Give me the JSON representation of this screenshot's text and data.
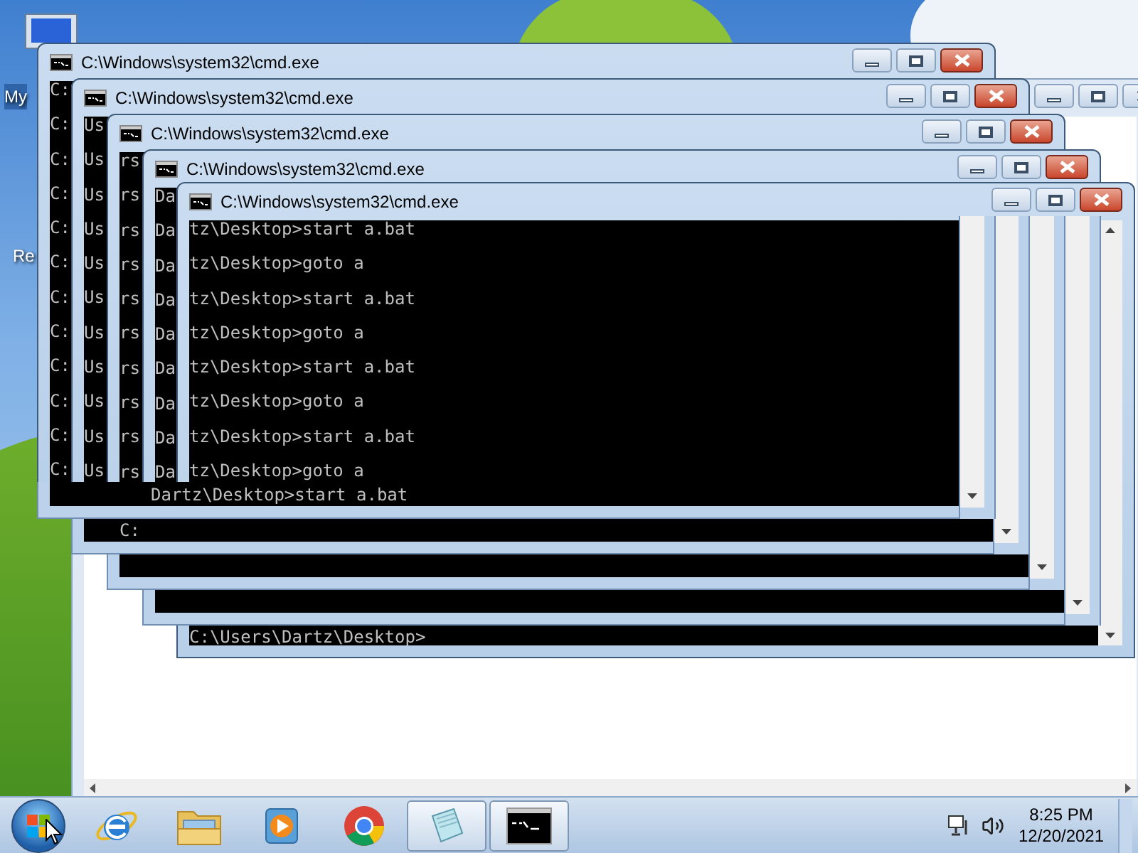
{
  "desktop_icons": [
    {
      "label": "My"
    },
    {
      "label": "Re"
    }
  ],
  "cmd_windows": [
    {
      "title": "C:\\Windows\\system32\\cmd.exe",
      "lines": [
        "C:",
        "C:",
        "C:",
        "C:",
        "C:",
        "C:",
        "C:",
        "C:",
        "C:",
        "C:",
        "C:",
        "C:"
      ],
      "bottom_line": "Dartz\\Desktop>start a.bat"
    },
    {
      "title": "C:\\Windows\\system32\\cmd.exe",
      "lines": [
        "Us",
        "Us",
        "Us",
        "Us",
        "Us",
        "Us",
        "Us",
        "Us",
        "Us",
        "Us",
        "Us"
      ],
      "bottom_line": "C:"
    },
    {
      "title": "C:\\Windows\\system32\\cmd.exe",
      "lines": [
        "rs",
        "rs",
        "rs",
        "rs",
        "rs",
        "rs",
        "rs",
        "rs",
        "rs",
        "rs"
      ]
    },
    {
      "title": "C:\\Windows\\system32\\cmd.exe",
      "lines": [
        "Da",
        "Da",
        "Da",
        "Da",
        "Da",
        "Da",
        "Da",
        "Da",
        "Da"
      ]
    },
    {
      "title": "C:\\Windows\\system32\\cmd.exe",
      "lines": [
        "tz\\Desktop>start a.bat",
        "tz\\Desktop>goto a",
        "tz\\Desktop>start a.bat",
        "tz\\Desktop>goto a",
        "tz\\Desktop>start a.bat",
        "tz\\Desktop>goto a",
        "tz\\Desktop>start a.bat",
        "tz\\Desktop>goto a"
      ],
      "bottom_line": "C:\\Users\\Dartz\\Desktop>"
    }
  ],
  "taskbar": {
    "buttons": [
      {
        "running": false
      },
      {
        "running": false
      },
      {
        "running": false
      },
      {
        "running": false
      },
      {
        "running": true
      },
      {
        "running": true
      }
    ],
    "clock": {
      "time": "8:25 PM",
      "date": "12/20/2021"
    }
  }
}
